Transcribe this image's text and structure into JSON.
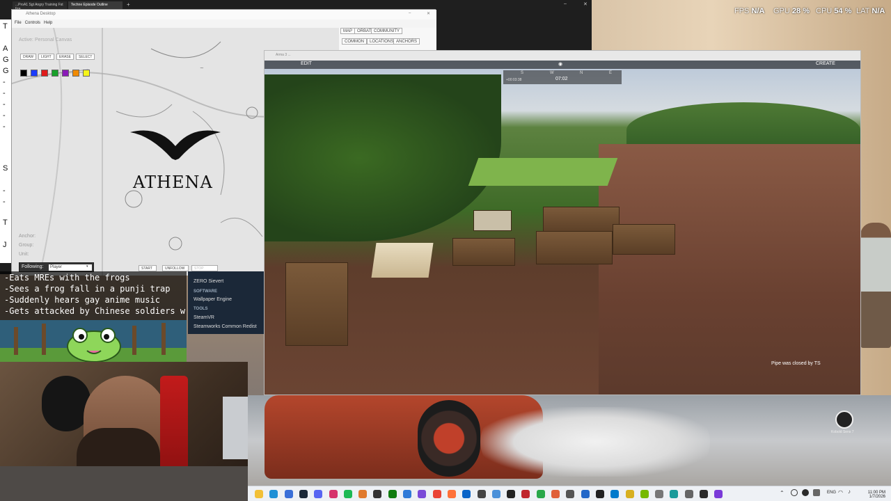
{
  "hud": {
    "fps_label": "FPS",
    "fps_value": "N/A",
    "gpu_label": "GPU",
    "gpu_value": "28 %",
    "cpu_label": "CPU",
    "cpu_value": "54 %",
    "lat_label": "LAT",
    "lat_value": "N/A"
  },
  "browser": {
    "tabs": [
      "...ProA1 Sgt Angry Training Fst Fre",
      "Techne Episode Outline"
    ]
  },
  "notes": {
    "chars": [
      "T",
      "A",
      "G",
      "G",
      "-",
      "-",
      "-",
      "-",
      "-",
      "S",
      "-",
      "-",
      "T",
      "J"
    ]
  },
  "athena": {
    "window_title": "Athena Desktop",
    "menu": [
      "File",
      "Controls",
      "Help"
    ],
    "active_label": "Active: Personal Canvas",
    "tools": [
      "DRAW",
      "LIGHT",
      "ERASE",
      "SELECT"
    ],
    "colors": [
      "#000000",
      "#1a3cff",
      "#e01b1b",
      "#18a02a",
      "#8a1ab8",
      "#f08a00",
      "#f5f51a"
    ],
    "logo_text": "ATHENA",
    "tabs": [
      "MAP",
      "ORBAT",
      "COMMUNITY"
    ],
    "subtabs": [
      "COMMON",
      "LOCATIONS",
      "ANCHORS"
    ],
    "anchor_label": "Anchor:",
    "group_label": "Group:",
    "unit_label": "Unit:",
    "following_label": "Following:",
    "following_value": "Player",
    "buttons": [
      "START",
      "UNFOLLOW",
      "STOP"
    ]
  },
  "chat": {
    "lines": [
      "-Eats MREs with the frogs",
      "-Sees a frog fall in a punji trap",
      "-Suddenly hears gay anime music",
      "-Gets attacked by Chinese soldiers w"
    ]
  },
  "steam": {
    "top_item": "ZERO Sievert",
    "software_head": "SOFTWARE",
    "software_item": "Wallpaper Engine",
    "tools_head": "TOOLS",
    "tools_items": [
      "SteamVR",
      "Steamworks Common Redist"
    ]
  },
  "game": {
    "title": "Arma 3 ...",
    "edit_label": "EDIT",
    "create_label": "CREATE",
    "compass": [
      "S",
      "W",
      "N",
      "E"
    ],
    "timer": "+00:03:38",
    "clock": "07:02",
    "notice": "Pipe was closed by TS"
  },
  "taskbar": {
    "lang": "ENG",
    "time": "11:00 PM",
    "date": "1/7/2026",
    "icons": [
      {
        "name": "file-explorer-icon",
        "color": "#f2c037"
      },
      {
        "name": "edge-icon",
        "color": "#1d8fd6"
      },
      {
        "name": "store-icon",
        "color": "#3a6fd8"
      },
      {
        "name": "steam-icon",
        "color": "#1b2838"
      },
      {
        "name": "discord-icon",
        "color": "#5865f2"
      },
      {
        "name": "music-icon",
        "color": "#d6336c"
      },
      {
        "name": "spotify-icon",
        "color": "#1db954"
      },
      {
        "name": "chat-icon",
        "color": "#e07a2e"
      },
      {
        "name": "obs-icon",
        "color": "#333333"
      },
      {
        "name": "xbox-icon",
        "color": "#107c10"
      },
      {
        "name": "photos-icon",
        "color": "#2f7ad8"
      },
      {
        "name": "gallery-icon",
        "color": "#7a4bd8"
      },
      {
        "name": "chrome-icon",
        "color": "#ea4335"
      },
      {
        "name": "firefox-icon",
        "color": "#ff7139"
      },
      {
        "name": "mail-icon",
        "color": "#0a64c8"
      },
      {
        "name": "video-icon",
        "color": "#444444"
      },
      {
        "name": "notepad-icon",
        "color": "#4a90d9"
      },
      {
        "name": "terminal-icon",
        "color": "#222222"
      },
      {
        "name": "app-red-icon",
        "color": "#c0262d"
      },
      {
        "name": "app-green-icon",
        "color": "#2aa84a"
      },
      {
        "name": "paint-icon",
        "color": "#e0603a"
      },
      {
        "name": "camera-icon",
        "color": "#555555"
      },
      {
        "name": "app-blue-icon",
        "color": "#2468c8"
      },
      {
        "name": "unity-icon",
        "color": "#222222"
      },
      {
        "name": "vscode-icon",
        "color": "#007acc"
      },
      {
        "name": "app-yellow-icon",
        "color": "#d8b020"
      },
      {
        "name": "nvidia-icon",
        "color": "#76b900"
      },
      {
        "name": "app-gray-icon",
        "color": "#777777"
      },
      {
        "name": "app-teal-icon",
        "color": "#1a9a9a"
      },
      {
        "name": "settings-icon",
        "color": "#666666"
      },
      {
        "name": "app-dark-icon",
        "color": "#2a2a2a"
      },
      {
        "name": "app-purple-icon",
        "color": "#7a3ad8"
      }
    ]
  },
  "desktop": {
    "icon_label": "Kobold Sens 7"
  }
}
